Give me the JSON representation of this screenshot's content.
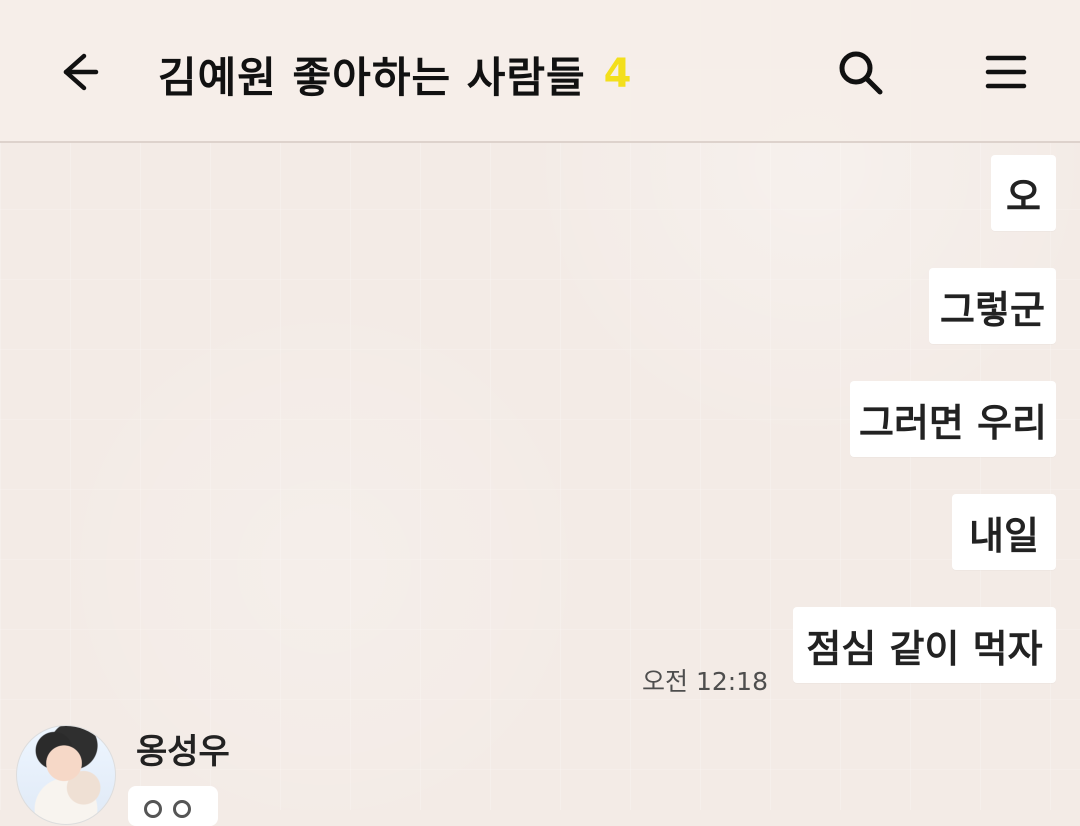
{
  "header": {
    "title": "김예원 좋아하는 사람들",
    "member_count": "4",
    "icons": {
      "back": "back-arrow-icon",
      "search": "search-icon",
      "menu": "menu-icon"
    }
  },
  "messages": {
    "outgoing": [
      "오",
      "그렇군",
      "그러면 우리",
      "내일",
      "점심 같이 먹자"
    ],
    "timestamp": "오전 12:18"
  },
  "incoming": {
    "sender_name": "옹성우"
  },
  "colors": {
    "background": "#f3ebe6",
    "bubble": "#ffffff",
    "title_text": "#111111",
    "member_count": "#f3df1c"
  }
}
